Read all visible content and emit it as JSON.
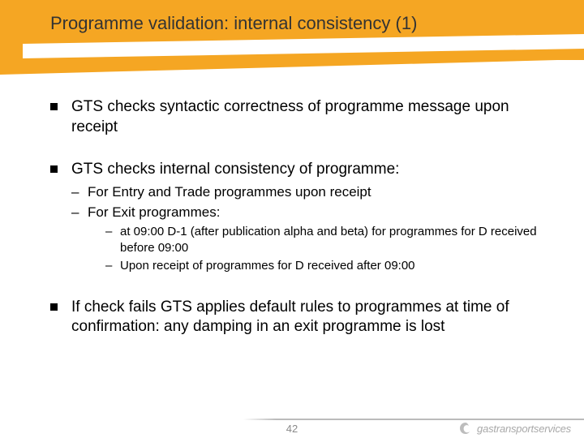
{
  "title": "Programme validation: internal consistency (1)",
  "bullets": [
    {
      "text": "GTS checks syntactic correctness of programme message upon receipt"
    },
    {
      "text": "GTS checks internal consistency of programme:",
      "sub": [
        {
          "text": "For Entry and Trade programmes upon receipt"
        },
        {
          "text": "For Exit programmes:",
          "sub": [
            {
              "text": "at 09:00 D-1 (after publication alpha and beta) for programmes for D received before 09:00"
            },
            {
              "text": "Upon receipt of programmes for D received after 09:00"
            }
          ]
        }
      ]
    },
    {
      "text": "If check fails GTS applies default rules to programmes at time of confirmation: any damping in an exit programme is lost"
    }
  ],
  "footer": {
    "page": "42",
    "brand": "gastransportservices"
  }
}
